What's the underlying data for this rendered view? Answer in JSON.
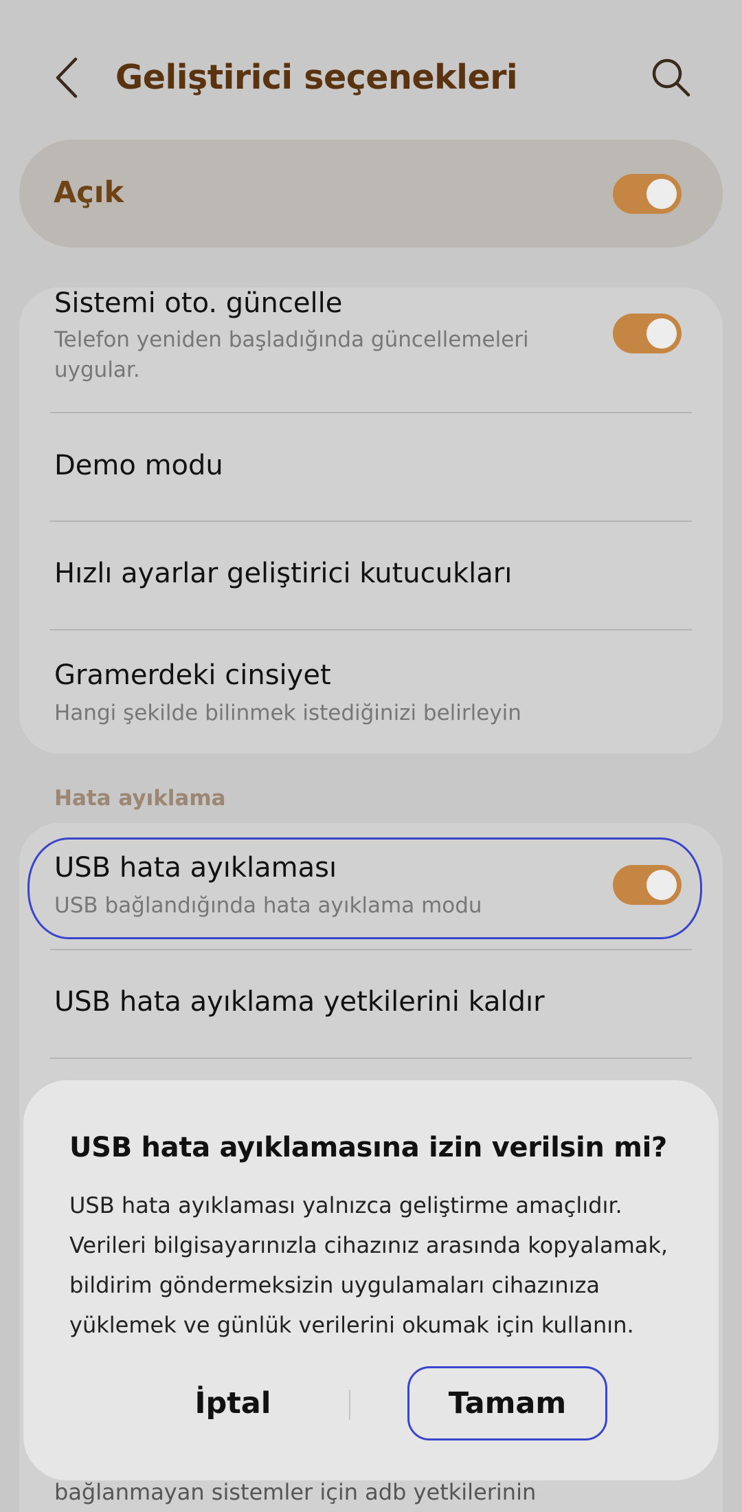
{
  "header": {
    "title": "Geliştirici seçenekleri",
    "back_icon": "chevron-left-icon",
    "search_icon": "search-icon"
  },
  "master_switch": {
    "label": "Açık",
    "on": true
  },
  "accent_color": "#c58543",
  "card1": {
    "items": [
      {
        "title": "Sistemi oto. güncelle",
        "subtitle_lines": [
          "Telefon yeniden başladığında güncellemeleri",
          "uygular."
        ],
        "toggle_on": true
      },
      {
        "title": "Demo modu"
      },
      {
        "title": "Hızlı ayarlar geliştirici kutucukları"
      },
      {
        "title": "Gramerdeki cinsiyet",
        "subtitle": "Hangi şekilde bilinmek istediğinizi belirleyin"
      }
    ]
  },
  "section": {
    "label": "Hata ayıklama"
  },
  "card2": {
    "items": [
      {
        "title": "USB hata ayıklaması",
        "subtitle": "USB bağlandığında hata ayıklama modu",
        "toggle_on": true
      },
      {
        "title": "USB hata ayıklama yetkilerini kaldır"
      }
    ]
  },
  "dialog": {
    "title": "USB hata ayıklamasına izin verilsin mi?",
    "body_lines": [
      "USB hata ayıklaması yalnızca geliştirme amaçlıdır.",
      "Verileri bilgisayarınızla cihazınız arasında kopyalamak,",
      "bildirim göndermeksizin uygulamaları cihazınıza",
      "yüklemek ve günlük verilerini okumak için kullanın."
    ],
    "cancel_label": "İptal",
    "ok_label": "Tamam"
  },
  "bottom_partial_text": "bağlanmayan sistemler için adb yetkilerinin"
}
